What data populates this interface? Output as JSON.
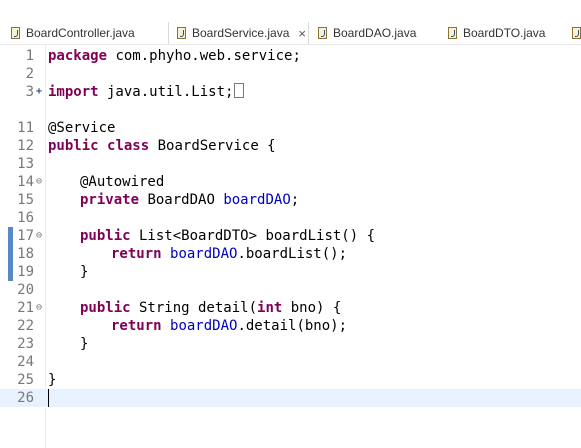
{
  "tabs": [
    {
      "label": "BoardController.java",
      "active": false
    },
    {
      "label": "BoardService.java",
      "active": true,
      "close": "×"
    },
    {
      "label": "BoardDAO.java",
      "active": false
    },
    {
      "label": "BoardDTO.java",
      "active": false
    }
  ],
  "editor": {
    "lines": [
      {
        "num": "1",
        "fold": "",
        "tokens": [
          [
            "kw",
            "package"
          ],
          [
            "",
            "com.phyho.web.service;"
          ]
        ]
      },
      {
        "num": "2",
        "fold": "",
        "tokens": []
      },
      {
        "num": "3",
        "fold": "+",
        "tokens": [
          [
            "kw",
            "import"
          ],
          [
            "",
            "java.util.List;"
          ]
        ]
      },
      {
        "num": "11",
        "fold": "",
        "tokens": []
      },
      {
        "num": "12",
        "fold": "",
        "tokens": []
      },
      {
        "num": "13",
        "fold": "",
        "tokens": []
      },
      {
        "num": "14",
        "fold": "-",
        "tokens": []
      },
      {
        "num": "15",
        "fold": "",
        "tokens": []
      },
      {
        "num": "16",
        "fold": "",
        "tokens": []
      },
      {
        "num": "17",
        "fold": "-",
        "tokens": []
      },
      {
        "num": "18",
        "fold": "",
        "tokens": []
      },
      {
        "num": "19",
        "fold": "",
        "tokens": []
      },
      {
        "num": "20",
        "fold": "",
        "tokens": []
      },
      {
        "num": "21",
        "fold": "-",
        "tokens": []
      },
      {
        "num": "22",
        "fold": "",
        "tokens": []
      },
      {
        "num": "23",
        "fold": "",
        "tokens": []
      },
      {
        "num": "24",
        "fold": "",
        "tokens": []
      },
      {
        "num": "25",
        "fold": "",
        "tokens": []
      },
      {
        "num": "26",
        "fold": "",
        "tokens": []
      }
    ],
    "code": {
      "l1_kw": "package",
      "l1_rest": " com.phyho.web.service;",
      "l3_kw": "import",
      "l3_rest": " java.util.List;",
      "l11": "@Service",
      "l12_kw1": "public",
      "l12_kw2": "class",
      "l12_rest": " BoardService {",
      "l14": "@Autowired",
      "l15_kw": "private",
      "l15_type": " BoardDAO ",
      "l15_field": "boardDAO",
      "l15_end": ";",
      "l17_kw": "public",
      "l17_rest": " List<BoardDTO> boardList() {",
      "l18_kw": "return",
      "l18_field": "boardDAO",
      "l18_rest": ".boardList();",
      "l19": "}",
      "l21_kw1": "public",
      "l21_mid": " String detail(",
      "l21_kw2": "int",
      "l21_rest": " bno) {",
      "l22_kw": "return",
      "l22_field": "boardDAO",
      "l22_rest": ".detail(bno);",
      "l23": "}",
      "l25": "}"
    }
  },
  "colors": {
    "keyword": "#7f0055",
    "annotation": "#646464",
    "field": "#0000c0",
    "current_line": "#e8f2fe",
    "change_marker": "#5a89c8"
  }
}
